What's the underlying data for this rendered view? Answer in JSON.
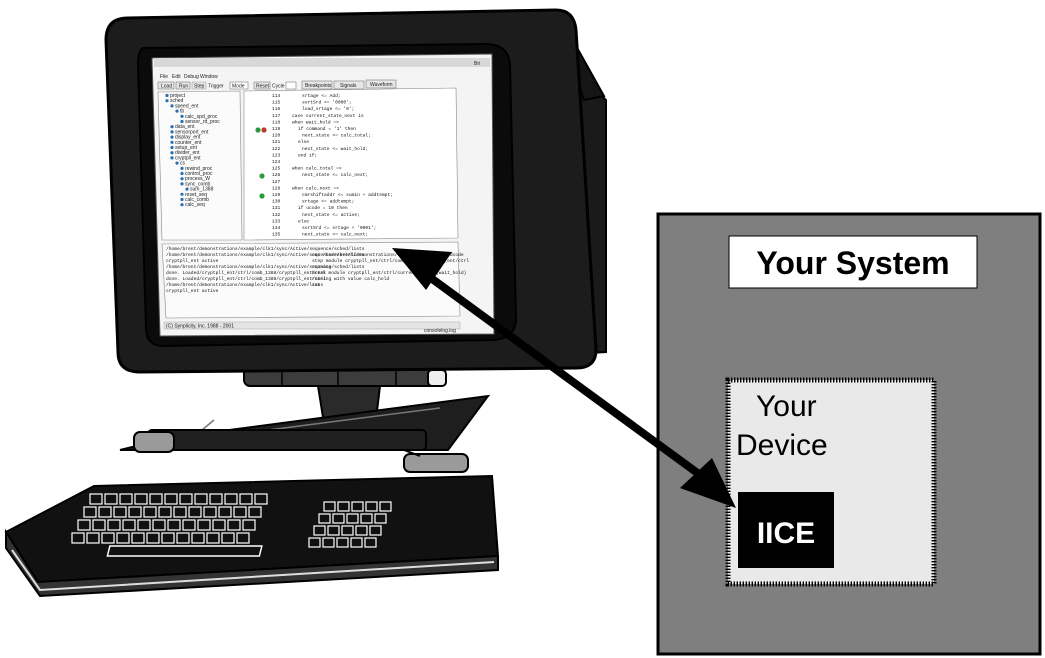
{
  "labels": {
    "system": "Your System",
    "device_line1": "Your",
    "device_line2": "Device",
    "iice": "IICE"
  },
  "screen": {
    "title_bar": "Bri",
    "menu": [
      "File",
      "Edit",
      "Debug",
      "Window"
    ],
    "toolbar": [
      "Load",
      "Run",
      "Step",
      "Trigger",
      "Mode",
      "Reset",
      "Cycle",
      "Breakpoints",
      "Signals",
      "Waveform"
    ],
    "tree": [
      "project",
      "sched",
      "speed_ent",
      "tb",
      "calc_spd_proc",
      "sensor_rd_proc",
      "data_ent",
      "sensorport_ent",
      "display_ent",
      "counter_ent",
      "setup_ent",
      "divider_ent",
      "cryptpll_ent",
      "cs",
      "rewind_proc",
      "control_proc",
      "process_W",
      "sync_comb",
      "sum_1388",
      "reset_seq",
      "calc_comb",
      "calc_seq"
    ],
    "line_numbers": [
      "114",
      "115",
      "116",
      "117",
      "118",
      "119",
      "120",
      "121",
      "122",
      "123",
      "124",
      "125",
      "126",
      "127",
      "128",
      "129",
      "130",
      "131",
      "132",
      "133",
      "134",
      "135"
    ],
    "code_lines": [
      "srtage <= Add;",
      "sortSrd <= '0000';",
      "load_srtage <= '0';",
      "case current_state_next is",
      "when wait_hold =>",
      "if command = '1' then",
      "next_state <= calc_total;",
      "else",
      "next_state <= wait_hold;",
      "end if;",
      "",
      "when calc_total =>",
      "next_state <= calc_next;",
      "",
      "when calc_next =>",
      "cmrshiftaddr <= sumin + addtempt;",
      "srtage <= addtempt;",
      "if ucode = 10 then",
      "next_state <= active;",
      "else",
      "sortSrd <= srtage + '0001';",
      "next_state <= calc_next;"
    ],
    "console": [
      "/home/brent/demonstrations/example/clk1/sync/Active/sequence/sched/lists",
      "/home/brent/demonstrations/example/clk1/sync/Active/sequence/reset/lists",
      "cryptpll_ent active",
      "/home/brent/demonstrations/example/clk1/sync/Active/sequence/sched/lists",
      "done. Loaded/cryptpll_ent/ctrl/comb_1388/cryptpll_ent/ctrl",
      "done. Loaded/cryptpll_ent/ctrl/comb_1388/cryptpll_ent/ctrl",
      "/home/brent/demonstrations/example/clk1/sync/Active/lists",
      "cryptpll_ent active"
    ],
    "console_right": [
      "cmr /home/brent/demonstrations/example/clk1/iceprodcode",
      "step module cryptpll_ent/ctrl/comb_1388/cryptpll_ent/ctrl",
      "running",
      "break module cryptpll_ent/ctrl/current_state (wait_hold)",
      "running with value calc_hold",
      "run"
    ],
    "status_left": "(C) Synplicity, Inc. 1988 - 2001",
    "status_right": "consolelog.log"
  }
}
